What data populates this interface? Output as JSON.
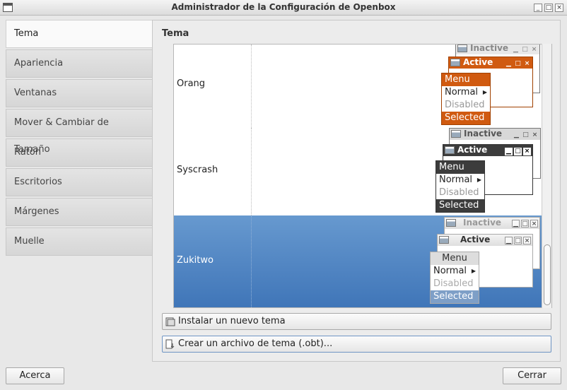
{
  "window": {
    "title": "Administrador de la Configuración de Openbox",
    "controls": {
      "minimize": "_",
      "maximize": "□",
      "close": "×"
    }
  },
  "sidebar": {
    "items": [
      {
        "label": "Tema",
        "active": true
      },
      {
        "label": "Apariencia"
      },
      {
        "label": "Ventanas"
      },
      {
        "label": "Mover & Cambiar de Tamaño"
      },
      {
        "label": "Ratón"
      },
      {
        "label": "Escritorios"
      },
      {
        "label": "Márgenes"
      },
      {
        "label": "Muelle"
      }
    ]
  },
  "main": {
    "title": "Tema",
    "themes": [
      {
        "name": "Orang",
        "selected": false
      },
      {
        "name": "Syscrash",
        "selected": false
      },
      {
        "name": "Zukitwo",
        "selected": true
      }
    ],
    "preview": {
      "inactive": "Inactive",
      "active": "Active",
      "menu": "Menu",
      "normal": "Normal",
      "disabled": "Disabled",
      "selected": "Selected",
      "btn_min": "▁",
      "btn_max": "□",
      "btn_close": "×"
    },
    "install_button": "Instalar un nuevo tema",
    "create_button": "Crear un archivo de tema (.obt)..."
  },
  "footer": {
    "about_button": "Acerca",
    "close_button": "Cerrar"
  },
  "colors": {
    "accent": "#4a80c0",
    "orang": "#d05a10",
    "syscrash": "#3c3c3c"
  }
}
